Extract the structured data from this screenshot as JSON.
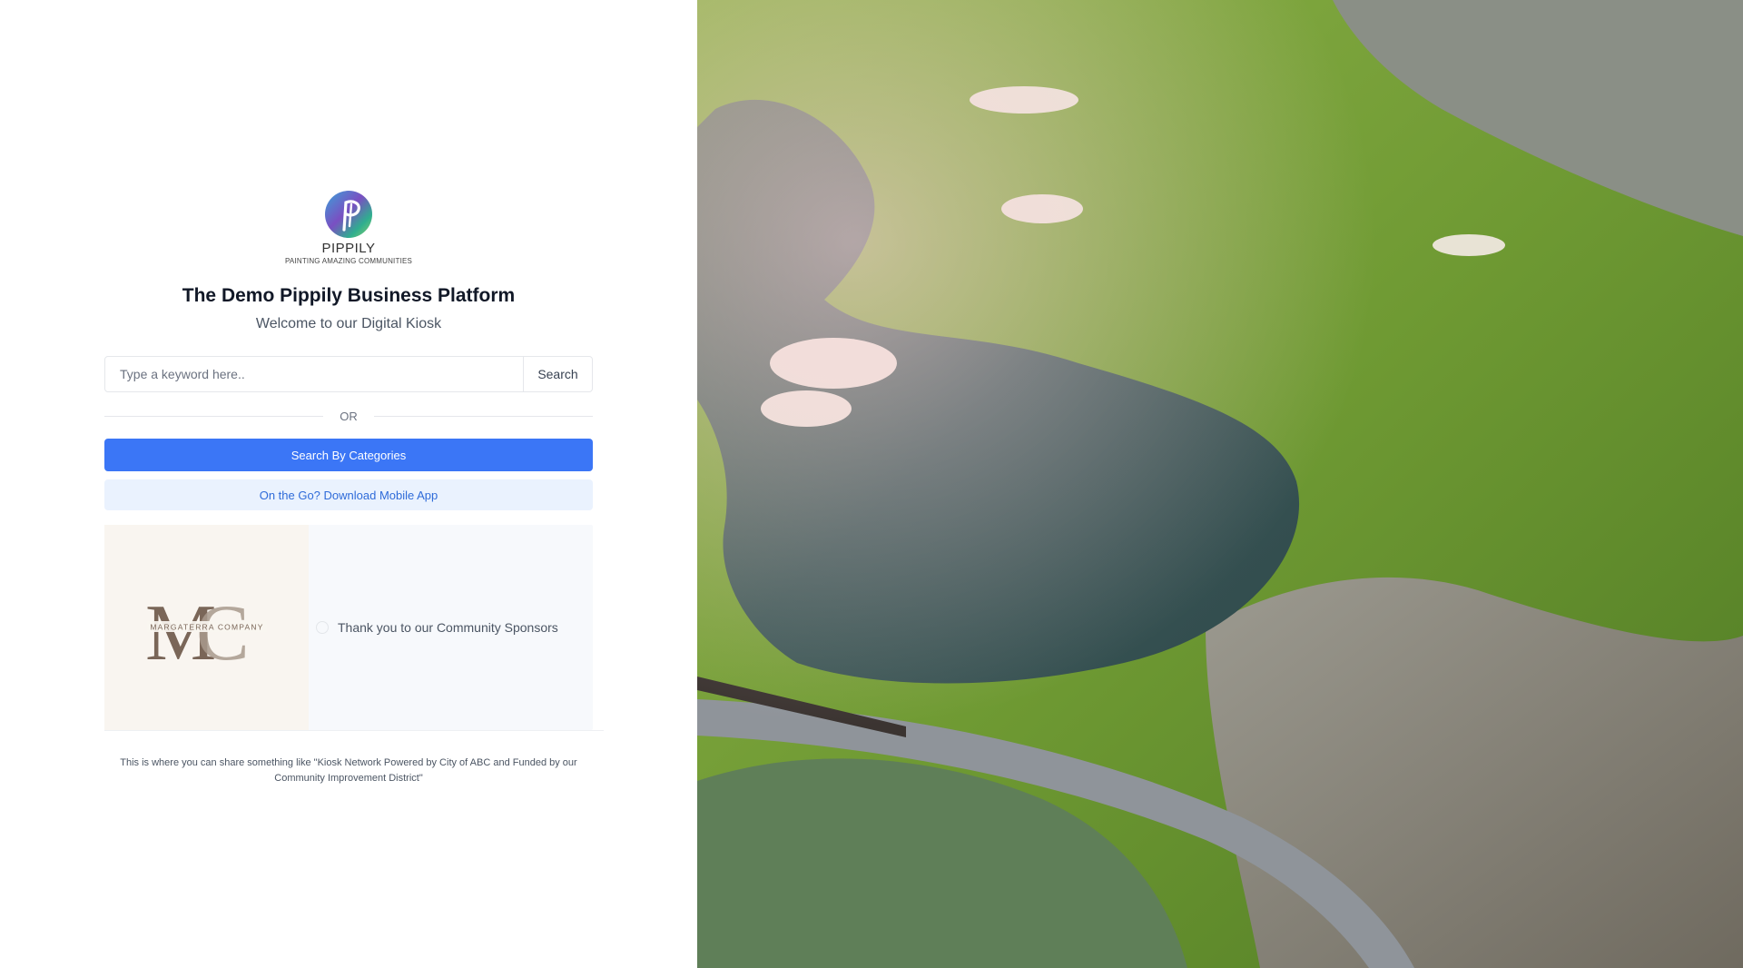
{
  "brand": {
    "name": "PIPPILY",
    "tagline": "PAINTING AMAZING COMMUNITIES"
  },
  "header": {
    "title": "The Demo Pippily Business Platform",
    "subtitle": "Welcome to our Digital Kiosk"
  },
  "search": {
    "placeholder": "Type a keyword here..",
    "button_label": "Search"
  },
  "divider": {
    "label": "OR"
  },
  "actions": {
    "categories_label": "Search By Categories",
    "mobile_app_label": "On the Go? Download Mobile App"
  },
  "sponsors": {
    "logo_text": "MARGATERRA COMPANY",
    "message": "Thank you to our Community Sponsors"
  },
  "footer": {
    "note": "This is where you can share something like \"Kiosk Network Powered by City of ABC and Funded by our Community Improvement District\""
  },
  "colors": {
    "primary": "#3b76f6",
    "secondary_bg": "#eaf2fe",
    "secondary_text": "#2f6bd9"
  }
}
